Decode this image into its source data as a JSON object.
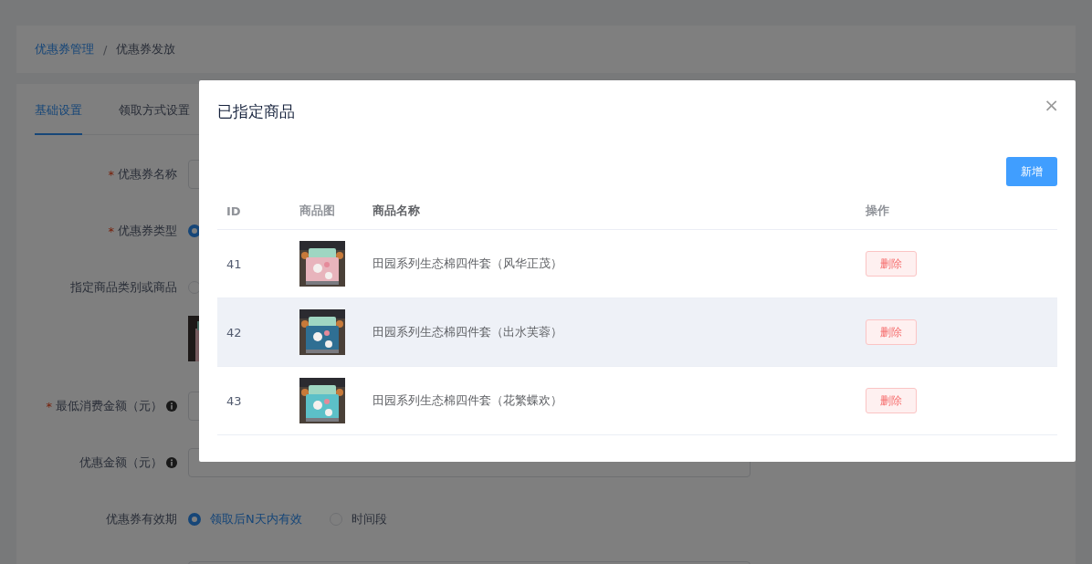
{
  "breadcrumb": [
    {
      "label": "优惠券管理",
      "selected": false
    },
    {
      "label": "/",
      "kind": "separator"
    },
    {
      "label": "优惠券发放",
      "selected": true
    }
  ],
  "tabs": [
    {
      "label": "基础设置",
      "selected": true
    },
    {
      "label": "领取方式设置",
      "selected": false
    }
  ],
  "form": [
    {
      "kind": "input",
      "label": "优惠券名称",
      "required_mark": "*"
    },
    {
      "kind": "radio",
      "label": "优惠券类型",
      "required_mark": "*",
      "options": [
        {
          "checked": true
        }
      ]
    },
    {
      "kind": "radio",
      "label": "指定商品类别或商品",
      "options": [
        {
          "checked": false
        }
      ]
    },
    {
      "kind": "picture"
    },
    {
      "kind": "input",
      "label": "最低消费金额（元）",
      "required_mark": "*",
      "info": true
    },
    {
      "kind": "input",
      "label": "优惠金额（元）",
      "info": true
    },
    {
      "kind": "radio",
      "label": "优惠券有效期",
      "options": [
        {
          "label": "领取后N天内有效",
          "checked": true
        },
        {
          "label": "时间段",
          "checked": false
        }
      ]
    },
    {
      "kind": "input"
    }
  ],
  "dialog": {
    "title": "已指定商品",
    "close": "×",
    "add_button": "新增",
    "columns": [
      "ID",
      "商品图",
      "商品名称",
      "操作"
    ],
    "rows": [
      {
        "id": "41",
        "image": {
          "kind": "picture"
        },
        "name": "田园系列生态棉四件套（风华正茂）",
        "action": "删除",
        "hovered": false
      },
      {
        "id": "42",
        "image": {
          "kind": "picture"
        },
        "name": "田园系列生态棉四件套（出水芙蓉）",
        "action": "删除",
        "hovered": true
      },
      {
        "id": "43",
        "image": {
          "kind": "picture"
        },
        "name": "田园系列生态棉四件套（花繁蝶欢）",
        "action": "删除",
        "hovered": false
      }
    ]
  }
}
